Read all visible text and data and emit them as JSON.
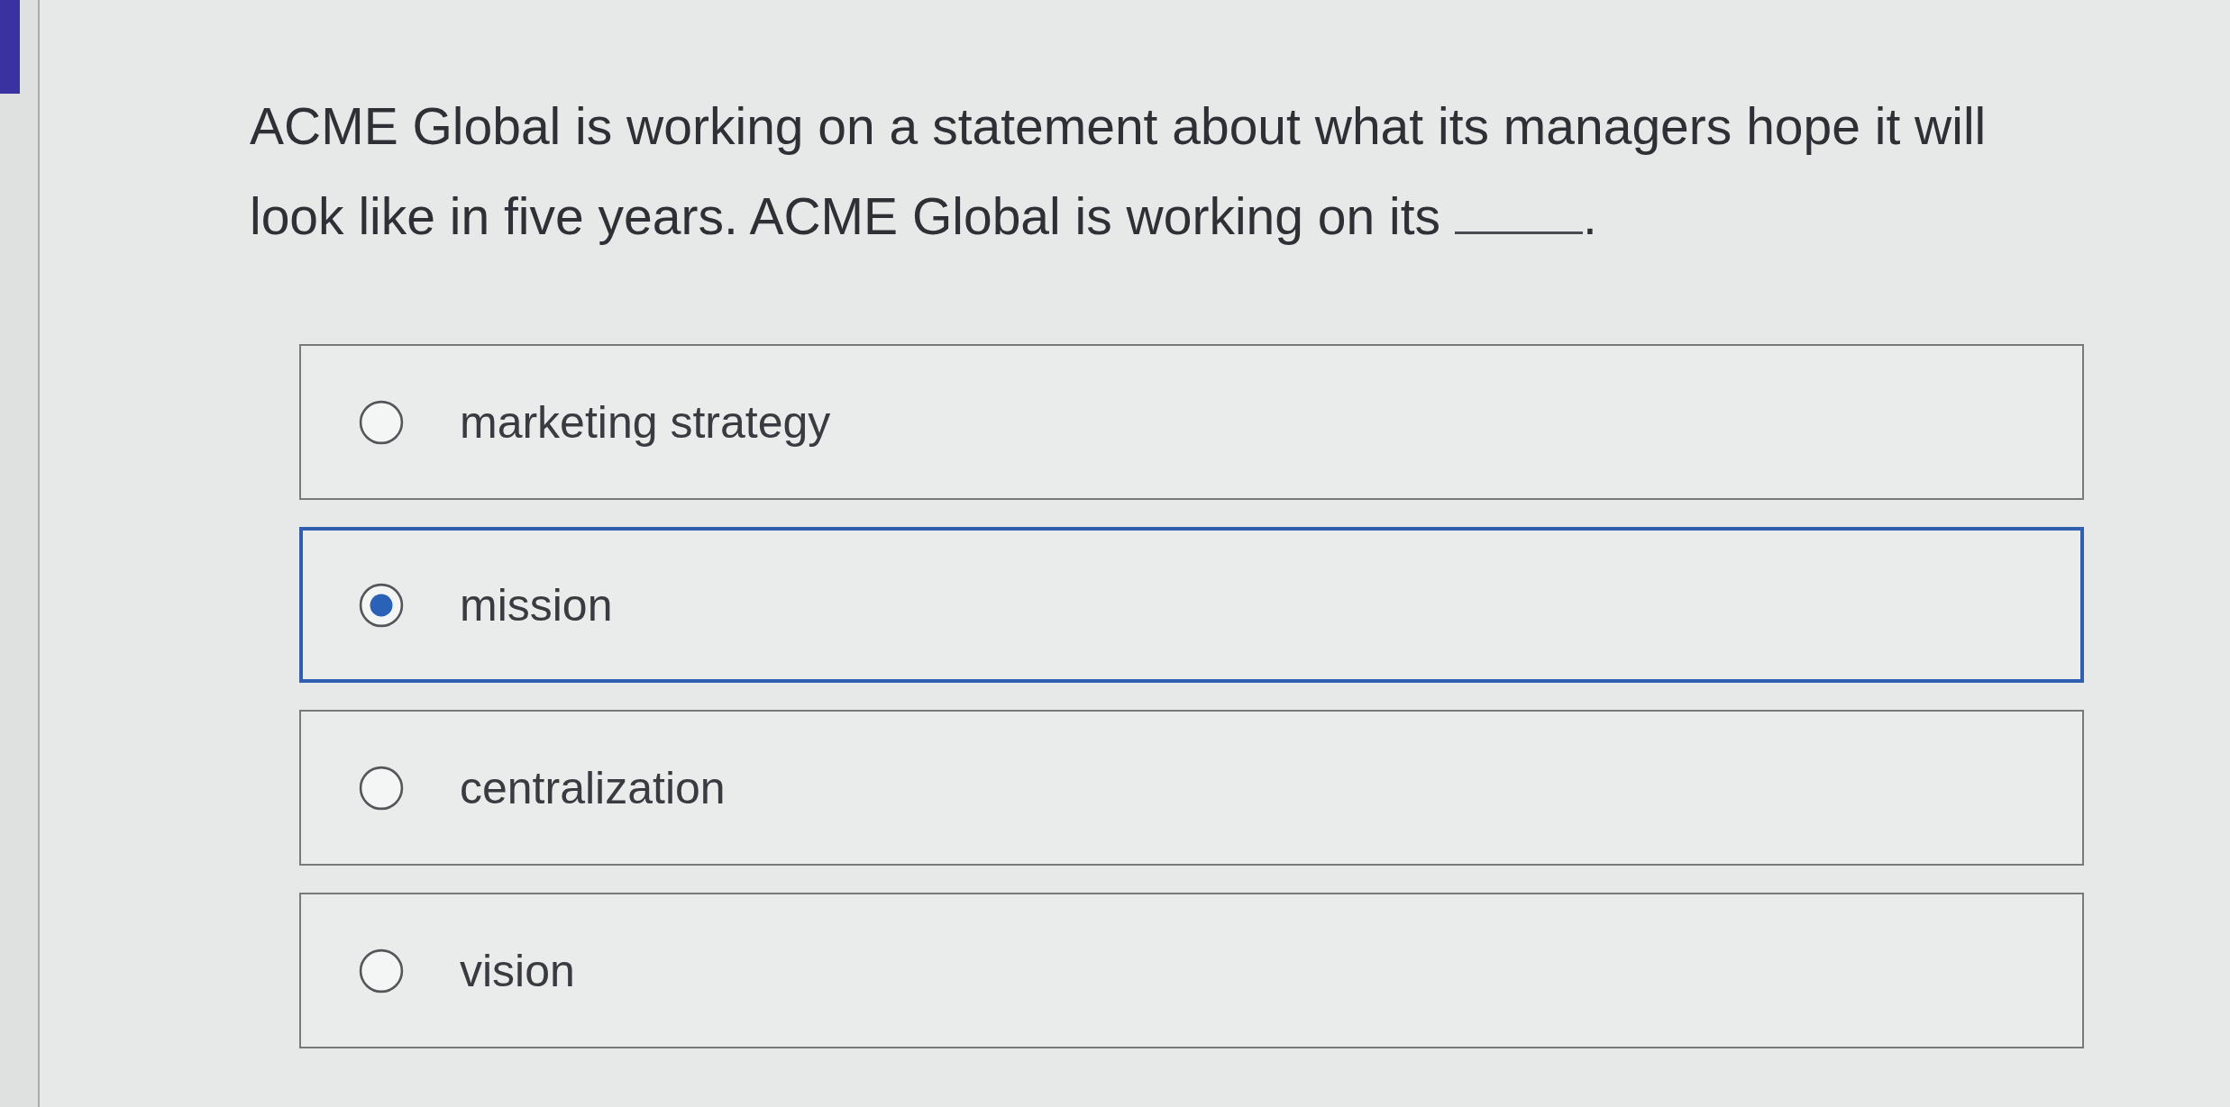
{
  "question": {
    "text": "ACME Global is working on a statement about what its managers hope it will look like in five years. ACME Global is working on its",
    "after_blank": "."
  },
  "options": [
    {
      "label": "marketing strategy",
      "selected": false
    },
    {
      "label": "mission",
      "selected": true
    },
    {
      "label": "centralization",
      "selected": false
    },
    {
      "label": "vision",
      "selected": false
    }
  ]
}
